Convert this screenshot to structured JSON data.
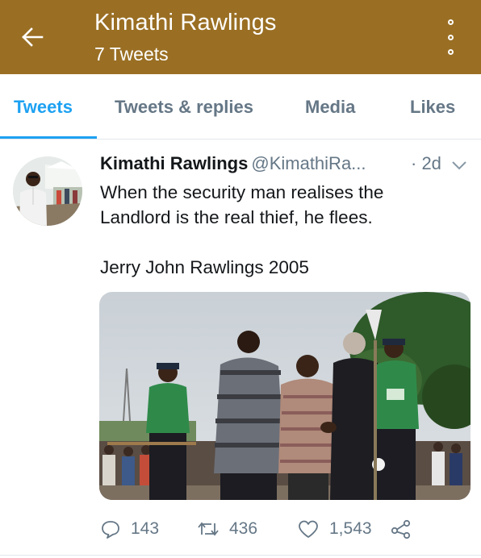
{
  "header": {
    "title": "Kimathi Rawlings",
    "subtitle": "7 Tweets",
    "back_icon": "arrow-left-icon",
    "more_icon": "vertical-more-icon",
    "background_color": "#9a6f24"
  },
  "tabs": [
    {
      "label": "Tweets",
      "active": true
    },
    {
      "label": "Tweets & replies",
      "active": false
    },
    {
      "label": "Media",
      "active": false
    },
    {
      "label": "Likes",
      "active": false
    }
  ],
  "accent_color": "#1da1f2",
  "tweet": {
    "author_name": "Kimathi Rawlings",
    "author_handle": "@KimathiRa...",
    "time": "· 2d",
    "text_lines": [
      "When the security man realises the",
      "Landlord is the real thief, he flees.",
      "Jerry John Rawlings 2005"
    ],
    "actions": {
      "replies": "143",
      "retweets": "436",
      "likes": "1,543"
    },
    "icons": {
      "reply": "comment-bubble-icon",
      "retweet": "retweet-icon",
      "like": "heart-icon",
      "share": "share-icon",
      "menu": "chevron-down-icon"
    }
  }
}
